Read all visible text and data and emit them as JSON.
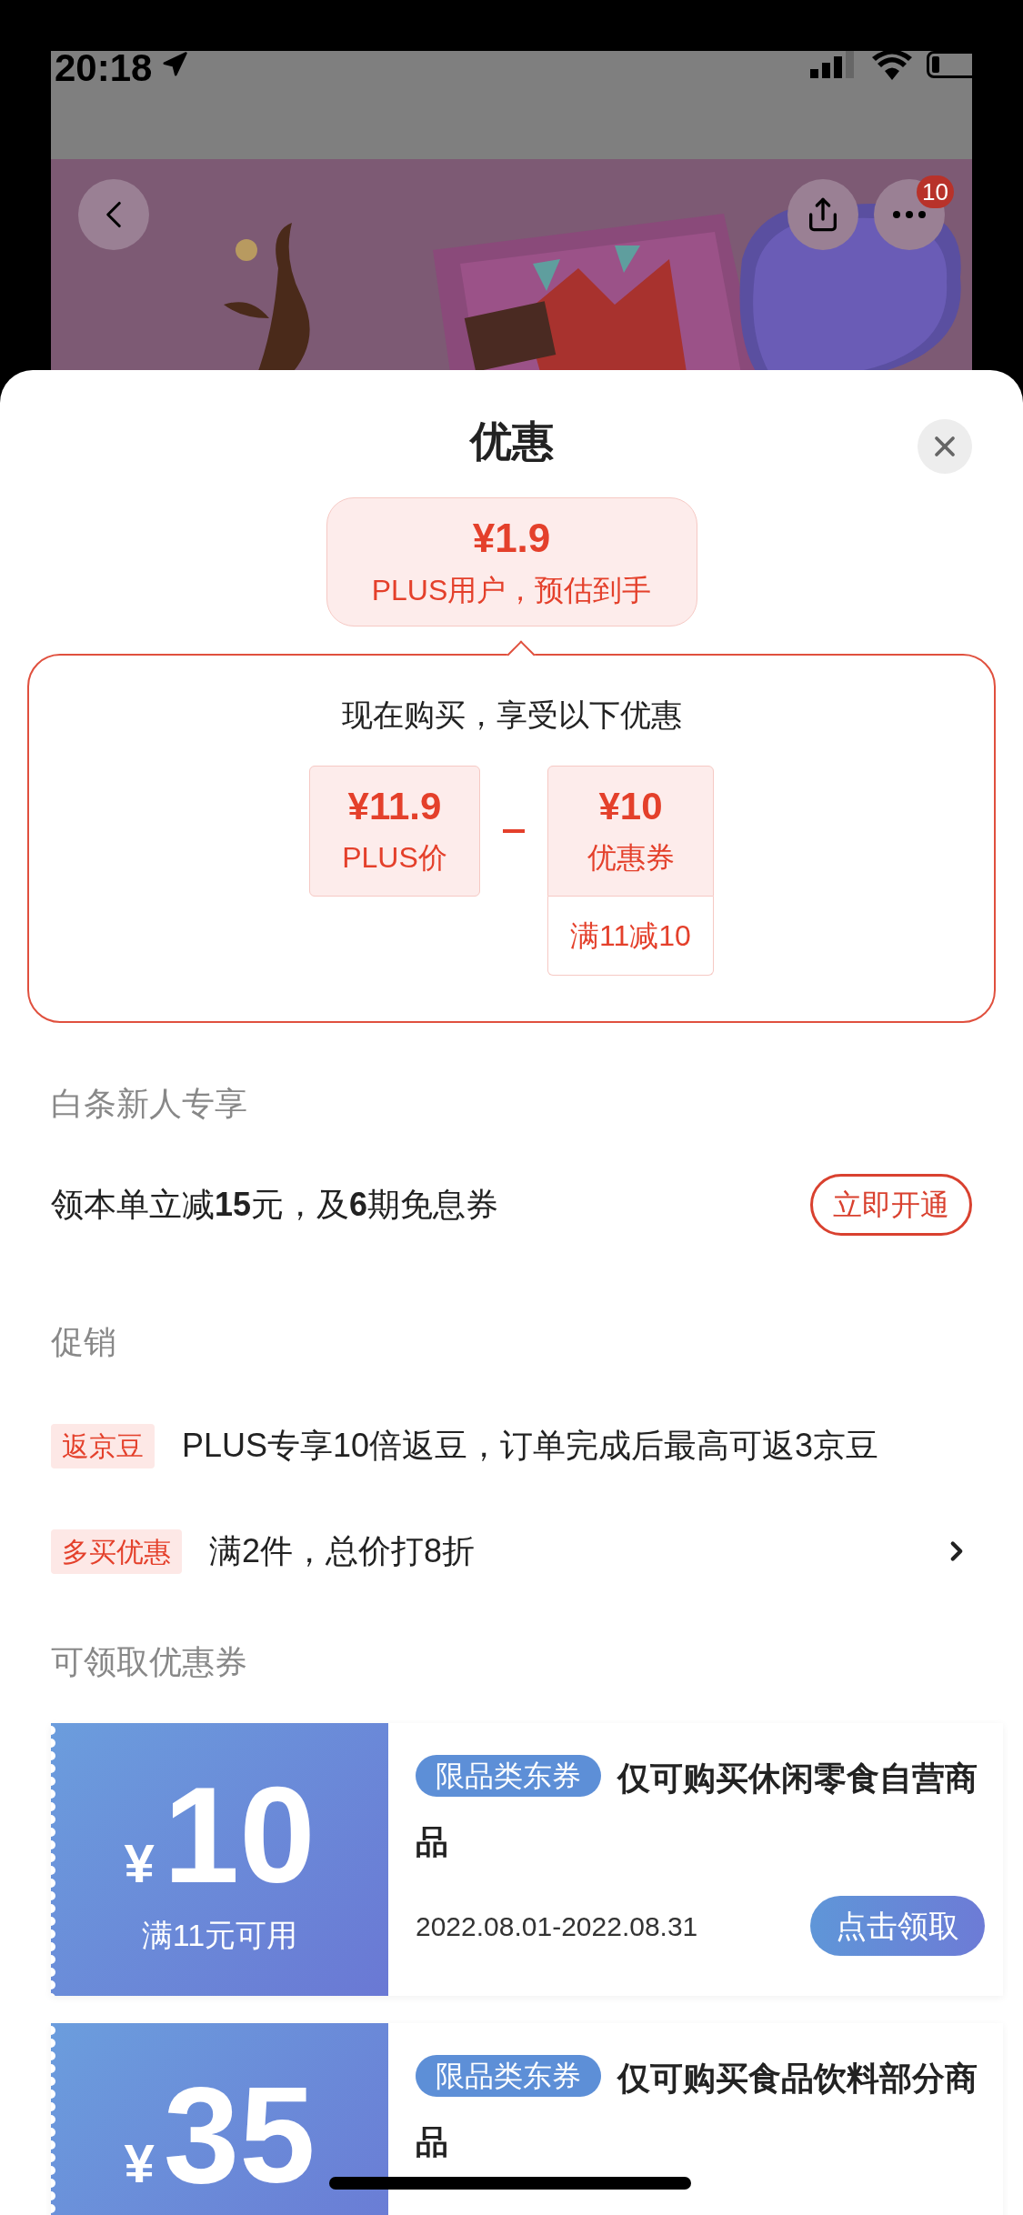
{
  "status_bar": {
    "time": "20:18"
  },
  "nav": {
    "badge": "10"
  },
  "sheet": {
    "title": "优惠"
  },
  "estimate": {
    "price": "¥1.9",
    "caption": "PLUS用户，预估到手"
  },
  "breakdown": {
    "heading": "现在购买，享受以下优惠",
    "items": [
      {
        "kind": "price",
        "amount": "¥11.9",
        "label": "PLUS价"
      },
      {
        "kind": "coupon",
        "amount": "¥10",
        "label": "优惠券",
        "condition": "满11减10"
      }
    ]
  },
  "baitiao": {
    "heading": "白条新人专享",
    "text": "领本单立减**15**元，及**6**期免息券",
    "button": "立即开通"
  },
  "promotions": {
    "heading": "促销",
    "items": [
      {
        "tag": "返京豆",
        "text": "PLUS专享10倍返豆，订单完成后最高可返3京豆",
        "has_arrow": false
      },
      {
        "tag": "多买优惠",
        "text": "满2件，总价打8折",
        "has_arrow": true
      }
    ]
  },
  "coupons": {
    "heading": "可领取优惠券",
    "items": [
      {
        "currency": "¥",
        "amount": "10",
        "condition": "满11元可用",
        "tag": "限品类东券",
        "title": "仅可购买休闲零食自营商品",
        "validity": "2022.08.01-2022.08.31",
        "button": "点击领取"
      },
      {
        "currency": "¥",
        "amount": "35",
        "tag": "限品类东券",
        "title": "仅可购买食品饮料部分商品"
      }
    ]
  }
}
